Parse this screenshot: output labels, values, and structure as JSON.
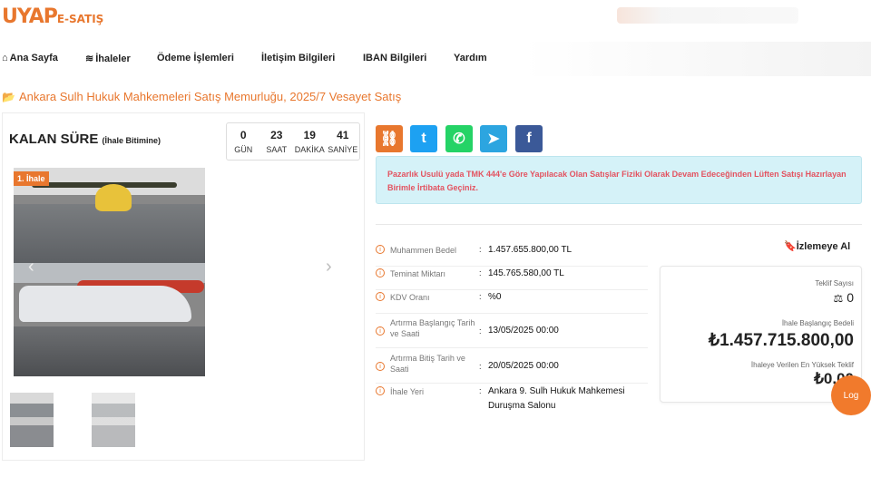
{
  "brand": {
    "logo": "UYAP",
    "logo_sub": "E-SATIŞ"
  },
  "nav": [
    {
      "label": "Ana Sayfa",
      "icon": "home-icon"
    },
    {
      "label": "İhaleler",
      "icon": "layers-icon"
    },
    {
      "label": "Ödeme İşlemleri"
    },
    {
      "label": "İletişim Bilgileri"
    },
    {
      "label": "IBAN Bilgileri"
    },
    {
      "label": "Yardım"
    }
  ],
  "breadcrumb": {
    "icon": "folder-open-icon",
    "text": "Ankara Sulh Hukuk Mahkemeleri Satış Memurluğu, 2025/7 Vesayet Satış"
  },
  "countdown": {
    "title": "KALAN SÜRE",
    "subtitle": "(İhale Bitimine)",
    "units": [
      {
        "value": "0",
        "label": "GÜN"
      },
      {
        "value": "23",
        "label": "SAAT"
      },
      {
        "value": "19",
        "label": "DAKİKA"
      },
      {
        "value": "41",
        "label": "SANİYE"
      }
    ]
  },
  "gallery": {
    "badge": "1. İhale",
    "prev_icon": "chevron-left-icon",
    "next_icon": "chevron-right-icon"
  },
  "share": [
    {
      "icon": "link-icon",
      "color": "#e8772e",
      "glyph": "🔗"
    },
    {
      "icon": "twitter-icon",
      "color": "#1da1f2",
      "glyph": "t"
    },
    {
      "icon": "whatsapp-icon",
      "color": "#25d366",
      "glyph": "✆"
    },
    {
      "icon": "telegram-icon",
      "color": "#2ca5e0",
      "glyph": "➤"
    },
    {
      "icon": "facebook-icon",
      "color": "#3b5998",
      "glyph": "f"
    }
  ],
  "alert": "Pazarlık Usulü yada TMK 444'e Göre Yapılacak Olan Satışlar Fiziki Olarak Devam Edeceğinden Lüften Satışı Hazırlayan Birimle İrtibata Geçiniz.",
  "details": [
    {
      "label": "Muhammen Bedel",
      "value": "1.457.655.800,00 TL"
    },
    {
      "label": "Teminat Miktarı",
      "value": "145.765.580,00 TL"
    },
    {
      "label": "KDV Oranı",
      "value": "%0"
    },
    {
      "label": "Artırma Başlangıç Tarih ve Saati",
      "value": "13/05/2025 00:00"
    },
    {
      "label": "Artırma Bitiş Tarih ve Saati",
      "value": "20/05/2025 00:00"
    },
    {
      "label": "İhale Yeri",
      "value": "Ankara 9. Sulh Hukuk Mahkemesi Duruşma Salonu"
    }
  ],
  "watch": {
    "label": "İzlemeye Al",
    "icon": "bookmark-icon"
  },
  "card": {
    "bids_label": "Teklif Sayısı",
    "bids_icon": "gavel-icon",
    "bids_count": "0",
    "start_label": "İhale Başlangıç Bedeli",
    "start_value": "₺1.457.715.800,00",
    "highest_label": "İhaleye Verilen En Yüksek Teklif",
    "highest_value": "₺0,00"
  },
  "chat": {
    "label": "Log"
  }
}
